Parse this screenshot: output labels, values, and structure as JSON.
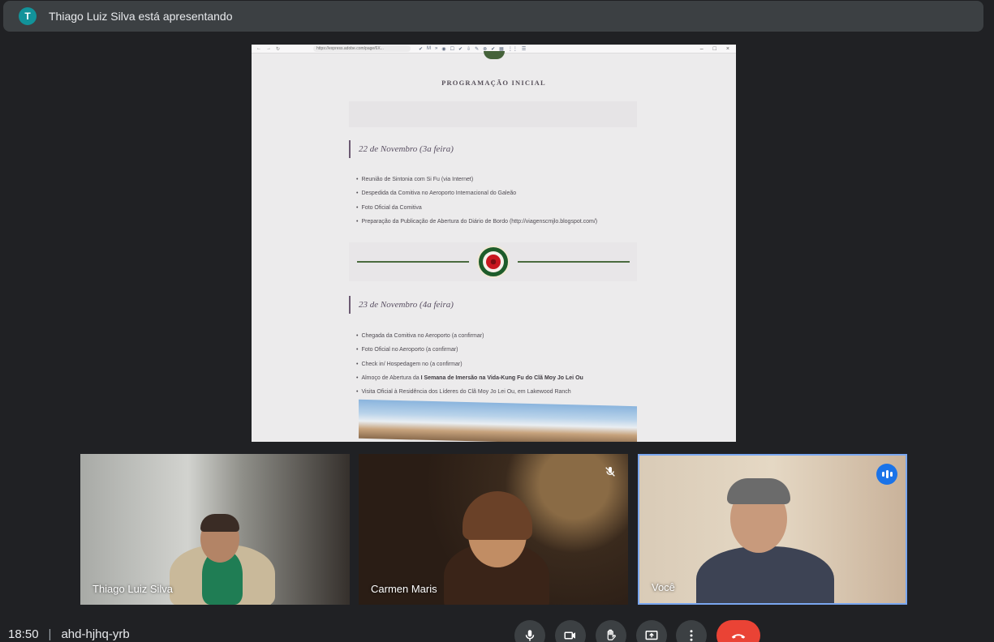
{
  "banner": {
    "avatar_letter": "T",
    "text": "Thiago Luiz Silva está apresentando"
  },
  "screen": {
    "url": "https://express.adobe.com/page/6X...",
    "title": "PROGRAMAÇÃO INICIAL",
    "day1": {
      "heading": "22 de Novembro (3a feira)",
      "items": [
        "Reunião de Sintonia com Si Fu (via Internet)",
        "Despedida da Comitiva no Aeroporto Internacional do Galeão",
        "Foto Oficial da Comitiva",
        "Preparação da Publicação de Abertura do Diário de Bordo (http://viagenscmjlo.blogspot.com/)"
      ]
    },
    "day2": {
      "heading": "23 de Novembro (4a feira)",
      "items": [
        "Chegada da Comitiva no Aeroporto (a confirmar)",
        "Foto Oficial no Aeroporto (a confirmar)",
        "Check in/ Hospedagem no (a confirmar)"
      ],
      "item4_prefix": "Almoço de Abertura da ",
      "item4_bold": "I Semana de Imersão na Vida-Kung Fu do Clã Moy Jo Lei Ou",
      "item5": "Visita Oficial à Residência dos Líderes do Clã Moy Jo Lei Ou, em Lakewood Ranch"
    }
  },
  "participants": [
    {
      "name": "Thiago Luiz Silva"
    },
    {
      "name": "Carmen Maris",
      "muted": true
    },
    {
      "name": "Você",
      "speaking": true
    }
  ],
  "footer": {
    "time": "18:50",
    "separator": "|",
    "meeting_code": "ahd-hjhq-yrb"
  },
  "colors": {
    "background": "#202124",
    "banner": "#3c4043",
    "leave": "#ea4335",
    "active_speaker": "#1a73e8"
  },
  "icons": [
    "mic-icon",
    "camera-icon",
    "raise-hand-icon",
    "present-icon",
    "more-options-icon",
    "hang-up-icon"
  ]
}
